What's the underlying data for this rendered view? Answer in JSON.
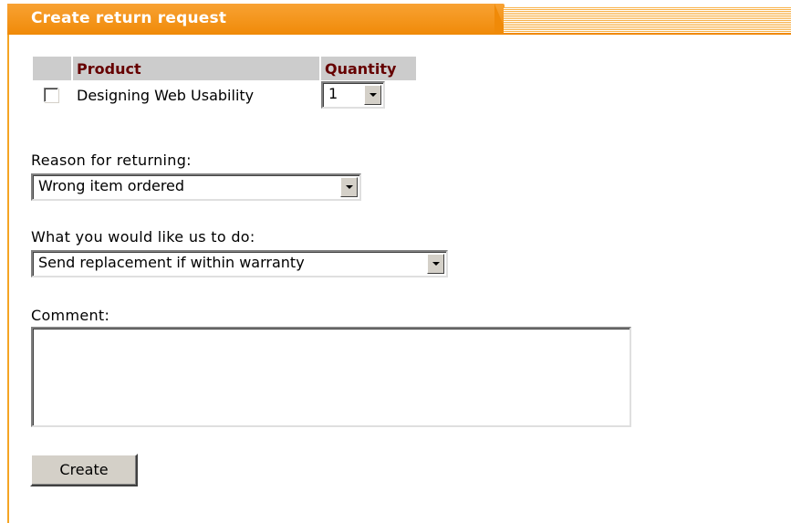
{
  "panel": {
    "title": "Create return request",
    "accent_color": "#f08a08"
  },
  "product_table": {
    "headers": {
      "select": "",
      "product": "Product",
      "quantity": "Quantity"
    },
    "rows": [
      {
        "checked": false,
        "product": "Designing Web Usability",
        "quantity": "1"
      }
    ]
  },
  "reason": {
    "label": "Reason for returning:",
    "selected": "Wrong item ordered"
  },
  "action": {
    "label": "What you would like us to do:",
    "selected": "Send replacement if within warranty"
  },
  "comment": {
    "label": "Comment:",
    "value": ""
  },
  "buttons": {
    "create_label": "Create"
  }
}
